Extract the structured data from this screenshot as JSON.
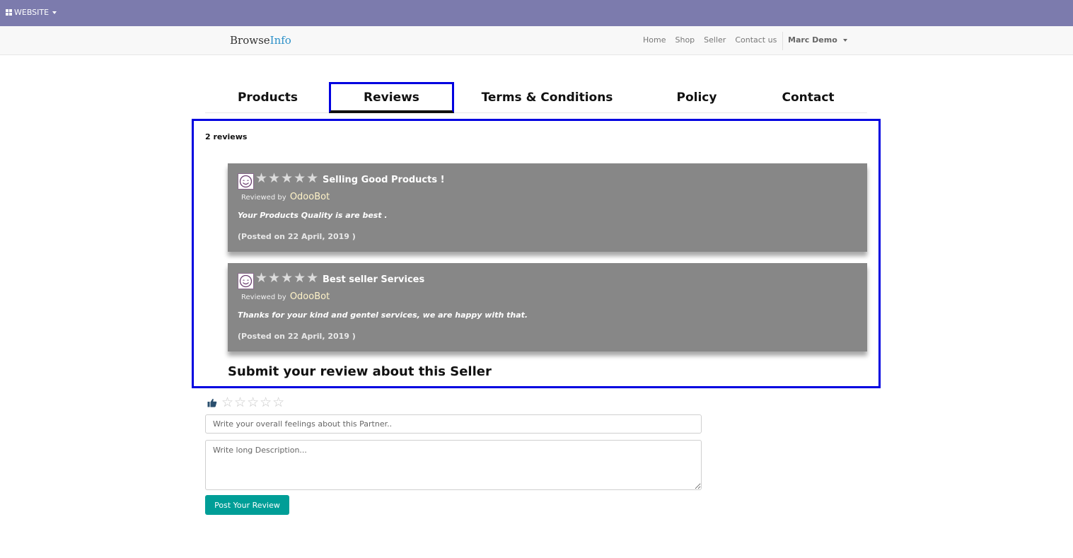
{
  "admin_bar": {
    "menu_label": "WEBSITE",
    "bg_color": "#7c7bad"
  },
  "site_nav": {
    "brand_part1": "Browse",
    "brand_part2": "Info",
    "links": [
      "Home",
      "Shop",
      "Seller",
      "Contact us"
    ],
    "user_name": "Marc Demo"
  },
  "tabs": {
    "items": [
      "Products",
      "Reviews",
      "Terms & Conditions",
      "Policy",
      "Contact"
    ],
    "active": "Reviews"
  },
  "reviews": {
    "count_label": "2 reviews",
    "items": [
      {
        "rating": 5,
        "title": "Selling Good Products !",
        "reviewed_by_label": "Reviewed by",
        "reviewer": "OdooBot",
        "comment": "Your Products Quality is are best .",
        "posted": "(Posted on 22 April, 2019 )"
      },
      {
        "rating": 5,
        "title": "Best seller Services",
        "reviewed_by_label": "Reviewed by",
        "reviewer": "OdooBot",
        "comment": "Thanks for your kind and gentel services, we are happy with that.",
        "posted": "(Posted on 22 April, 2019 )"
      }
    ]
  },
  "form": {
    "heading": "Submit your review about this Seller",
    "rating_value": 0,
    "short_placeholder": "Write your overall feelings about this Partner..",
    "long_placeholder": "Write long Description...",
    "submit_label": "Post Your Review",
    "button_color": "#009e97"
  },
  "highlight_color": "#0000e0"
}
